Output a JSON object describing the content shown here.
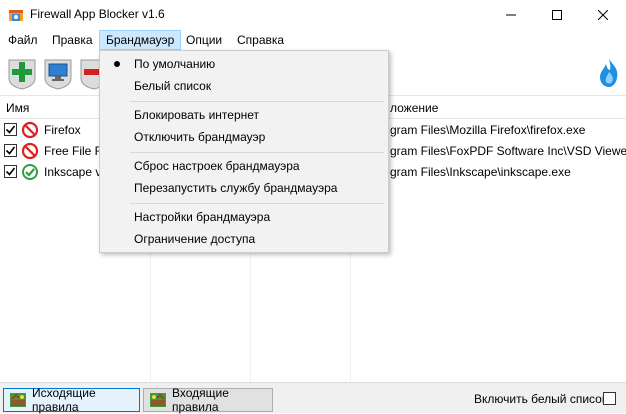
{
  "window": {
    "title": "Firewall App Blocker v1.6"
  },
  "menubar": {
    "items": [
      "Файл",
      "Правка",
      "Брандмауэр",
      "Опции",
      "Справка"
    ]
  },
  "firewall_menu": {
    "items": [
      {
        "label": "По умолчанию",
        "checked": true
      },
      {
        "label": "Белый список"
      },
      {
        "label": "Блокировать интернет"
      },
      {
        "label": "Отключить брандмауэр"
      },
      {
        "label": "Сброс настроек брандмауэра"
      },
      {
        "label": "Перезапустить службу брандмауэра"
      },
      {
        "label": "Настройки брандмауэра"
      },
      {
        "label": "Ограничение доступа"
      }
    ]
  },
  "toolbar": {
    "icons": [
      "add-icon",
      "computer-icon",
      "remove-icon",
      "flame-icon"
    ]
  },
  "list": {
    "columns": {
      "name": "Имя",
      "path_partial": "ложение"
    },
    "rows": [
      {
        "name": "Firefox",
        "status": "blocked",
        "checked": true,
        "path": "gram Files\\Mozilla Firefox\\firefox.exe"
      },
      {
        "name": "Free File Ren",
        "status": "blocked",
        "checked": true,
        "path": "gram Files\\FoxPDF Software Inc\\VSD Viewer\\VSDV"
      },
      {
        "name": "Inkscape vec",
        "status": "allowed",
        "checked": true,
        "path": "gram Files\\Inkscape\\inkscape.exe"
      }
    ]
  },
  "bottom": {
    "outgoing_label": "Исходящие правила",
    "incoming_label": "Входящие правила",
    "whitelist_label": "Включить белый список"
  },
  "colors": {
    "menu_active_bg": "#cce8ff",
    "blocked_red": "#e02020",
    "allowed_green": "#2ea043",
    "selected_tab_border": "#0078d7"
  }
}
